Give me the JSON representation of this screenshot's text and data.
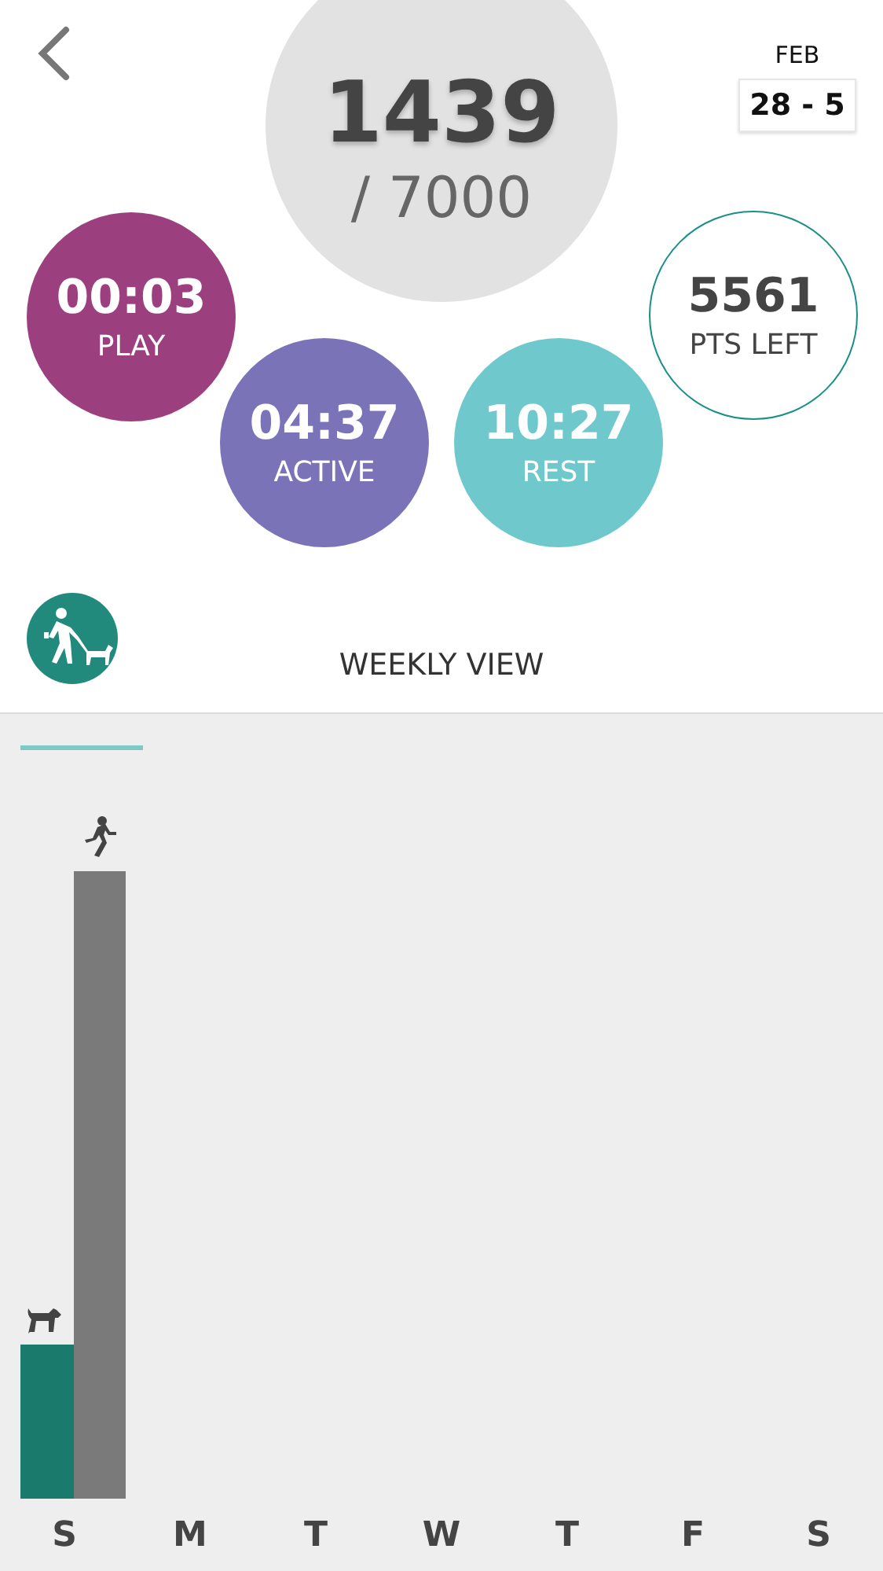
{
  "header": {
    "month": "FEB",
    "range": "28 - 5"
  },
  "goal": {
    "points": "1439",
    "target": "/ 7000"
  },
  "stats": [
    {
      "kind": "filled",
      "value": "00:03",
      "label": "PLAY",
      "color": "#9c3f7f"
    },
    {
      "kind": "filled",
      "value": "04:37",
      "label": "ACTIVE",
      "color": "#7b73b8"
    },
    {
      "kind": "filled",
      "value": "10:27",
      "label": "REST",
      "color": "#6fc9cc"
    },
    {
      "kind": "outline",
      "value": "5561",
      "label": "PTS LEFT",
      "color": "#1a8f86"
    }
  ],
  "section_title": "WEEKLY VIEW",
  "days": [
    {
      "label": "S",
      "selected": true
    },
    {
      "label": "M",
      "selected": false
    },
    {
      "label": "T",
      "selected": false
    },
    {
      "label": "W",
      "selected": false
    },
    {
      "label": "T",
      "selected": false
    },
    {
      "label": "F",
      "selected": false
    },
    {
      "label": "S",
      "selected": false
    }
  ]
}
